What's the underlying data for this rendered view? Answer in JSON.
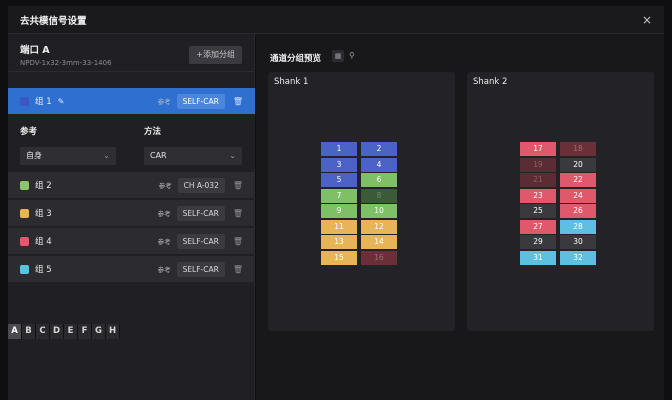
{
  "window": {
    "title": "去共模信号设置",
    "close_label": "×"
  },
  "port": {
    "name": "端口 A",
    "subtitle": "NPDV-1x32-3mm-33-1406",
    "add_group_label": "+添加分组"
  },
  "groups": [
    {
      "name": "组 1",
      "color": "#3b57c4",
      "ref_label": "参考",
      "ref_value": "SELF-CAR",
      "active": true
    },
    {
      "name": "组 2",
      "color": "#8cc66b",
      "ref_label": "参考",
      "ref_value": "CH A-032"
    },
    {
      "name": "组 3",
      "color": "#e8b45a",
      "ref_label": "参考",
      "ref_value": "SELF-CAR"
    },
    {
      "name": "组 4",
      "color": "#e0596a",
      "ref_label": "参考",
      "ref_value": "SELF-CAR"
    },
    {
      "name": "组 5",
      "color": "#5ec0e0",
      "ref_label": "参考",
      "ref_value": "SELF-CAR"
    }
  ],
  "detail": {
    "ref_heading": "参考",
    "method_heading": "方法",
    "ref_value": "自身",
    "method_value": "CAR"
  },
  "letters": [
    "A",
    "B",
    "C",
    "D",
    "E",
    "F",
    "G",
    "H"
  ],
  "selected_letter": "A",
  "preview": {
    "title": "通道分组预览",
    "grid_icon": "grid-icon",
    "pin_icon": "pin-icon"
  },
  "shanks": [
    {
      "title": "Shank 1",
      "rows": [
        [
          {
            "n": "1",
            "c": "#4a63c4"
          },
          {
            "n": "2",
            "c": "#4a63c4"
          }
        ],
        [
          {
            "n": "3",
            "c": "#4a63c4"
          },
          {
            "n": "4",
            "c": "#4a63c4"
          }
        ],
        [
          {
            "n": "5",
            "c": "#4a63c4"
          },
          {
            "n": "6",
            "c": "#7fbf65"
          }
        ],
        [
          {
            "n": "7",
            "c": "#7fbf65"
          },
          {
            "n": "8",
            "c": "#3d5a38",
            "t": "#6b8765"
          }
        ],
        [
          {
            "n": "9",
            "c": "#7fbf65"
          },
          {
            "n": "10",
            "c": "#7fbf65"
          }
        ],
        [
          {
            "n": "11",
            "c": "#e8b45a"
          },
          {
            "n": "12",
            "c": "#e8b45a"
          }
        ],
        [
          {
            "n": "13",
            "c": "#e8b45a"
          },
          {
            "n": "14",
            "c": "#e8b45a"
          }
        ],
        [
          {
            "n": "15",
            "c": "#e8b45a"
          },
          {
            "n": "16",
            "c": "#6b2f38",
            "t": "#9d6b72"
          }
        ]
      ]
    },
    {
      "title": "Shank 2",
      "rows": [
        [
          {
            "n": "17",
            "c": "#e0596a"
          },
          {
            "n": "18",
            "c": "#6b2f38",
            "t": "#9d6b72"
          }
        ],
        [
          {
            "n": "19",
            "c": "#5a2c33",
            "t": "#8f6068"
          },
          {
            "n": "20",
            "c": "#3a3a3e"
          }
        ],
        [
          {
            "n": "21",
            "c": "#5a2c33",
            "t": "#8f6068"
          },
          {
            "n": "22",
            "c": "#e0596a"
          }
        ],
        [
          {
            "n": "23",
            "c": "#e0596a"
          },
          {
            "n": "24",
            "c": "#e0596a"
          }
        ],
        [
          {
            "n": "25",
            "c": "#3a3a3e"
          },
          {
            "n": "26",
            "c": "#e0596a"
          }
        ],
        [
          {
            "n": "27",
            "c": "#e0596a"
          },
          {
            "n": "28",
            "c": "#5ec0e0"
          }
        ],
        [
          {
            "n": "29",
            "c": "#3a3a3e"
          },
          {
            "n": "30",
            "c": "#3a3a3e"
          }
        ],
        [
          {
            "n": "31",
            "c": "#5ec0e0"
          },
          {
            "n": "32",
            "c": "#5ec0e0"
          }
        ]
      ]
    }
  ]
}
